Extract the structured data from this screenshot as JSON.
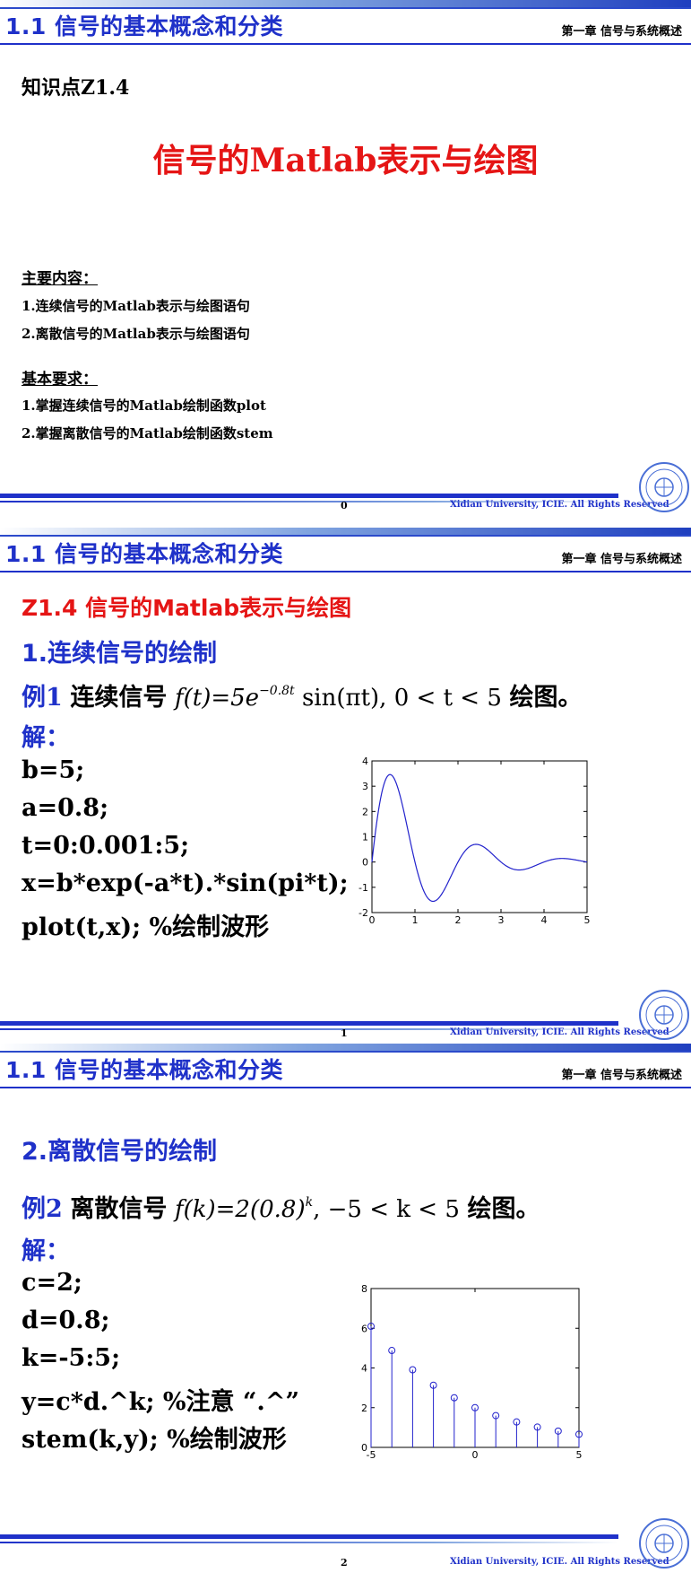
{
  "header": {
    "section_title": "1.1  信号的基本概念和分类",
    "chapter_label": "第一章  信号与系统概述",
    "copyright": "Xidian University, ICIE. All Rights Reserved"
  },
  "slides": [
    {
      "page_number": "0",
      "knowledge_point": "知识点Z1.4",
      "title": "信号的Matlab表示与绘图",
      "main_content_heading": "主要内容：",
      "main_content_items": [
        "1.连续信号的Matlab表示与绘图语句",
        "2.离散信号的Matlab表示与绘图语句"
      ],
      "requirements_heading": "基本要求：",
      "requirements_items": [
        "1.掌握连续信号的Matlab绘制函数plot",
        "2.掌握离散信号的Matlab绘制函数stem"
      ]
    },
    {
      "page_number": "1",
      "topic": "Z1.4  信号的Matlab表示与绘图",
      "heading": "1.连续信号的绘制",
      "example_label": "例1",
      "example_prefix": "连续信号",
      "example_formula_a": "f(t)=5e",
      "example_formula_exp": "−0.8t",
      "example_formula_b": " sin(πt), 0 < t < 5",
      "example_suffix": "绘图。",
      "solution_label": "解：",
      "code": [
        "b=5;",
        "a=0.8;",
        "t=0:0.001:5;",
        "x=b*exp(-a*t).*sin(pi*t);",
        "plot(t,x);    %绘制波形"
      ]
    },
    {
      "page_number": "2",
      "heading": "2.离散信号的绘制",
      "example_label": "例2",
      "example_prefix": "离散信号",
      "example_formula_a": "f(k)=2(0.8)",
      "example_formula_exp": "k",
      "example_formula_b": ", −5 < k < 5",
      "example_suffix": "绘图。",
      "solution_label": "解：",
      "code": [
        "c=2;",
        "d=0.8;",
        "k=-5:5;",
        "y=c*d.^k;  %注意 “.^”",
        "stem(k,y);  %绘制波形"
      ]
    }
  ],
  "chart_data": [
    {
      "type": "line",
      "xlim": [
        0,
        5
      ],
      "ylim": [
        -2,
        4
      ],
      "xticks": [
        "0",
        "1",
        "2",
        "3",
        "4",
        "5"
      ],
      "yticks": [
        "-2",
        "-1",
        "0",
        "1",
        "2",
        "3",
        "4"
      ],
      "function": "5*exp(-0.8*t)*sin(pi*t)",
      "x_range": [
        0,
        5
      ],
      "color": "#2222cc"
    },
    {
      "type": "stem",
      "xlim": [
        -5,
        5
      ],
      "ylim": [
        0,
        8
      ],
      "xticks": [
        "-5",
        "0",
        "5"
      ],
      "yticks": [
        "0",
        "2",
        "4",
        "6",
        "8"
      ],
      "x": [
        -5,
        -4,
        -3,
        -2,
        -1,
        0,
        1,
        2,
        3,
        4,
        5
      ],
      "y": [
        6.1,
        4.88,
        3.91,
        3.13,
        2.5,
        2.0,
        1.6,
        1.28,
        1.02,
        0.82,
        0.66
      ],
      "color": "#2222cc"
    }
  ]
}
